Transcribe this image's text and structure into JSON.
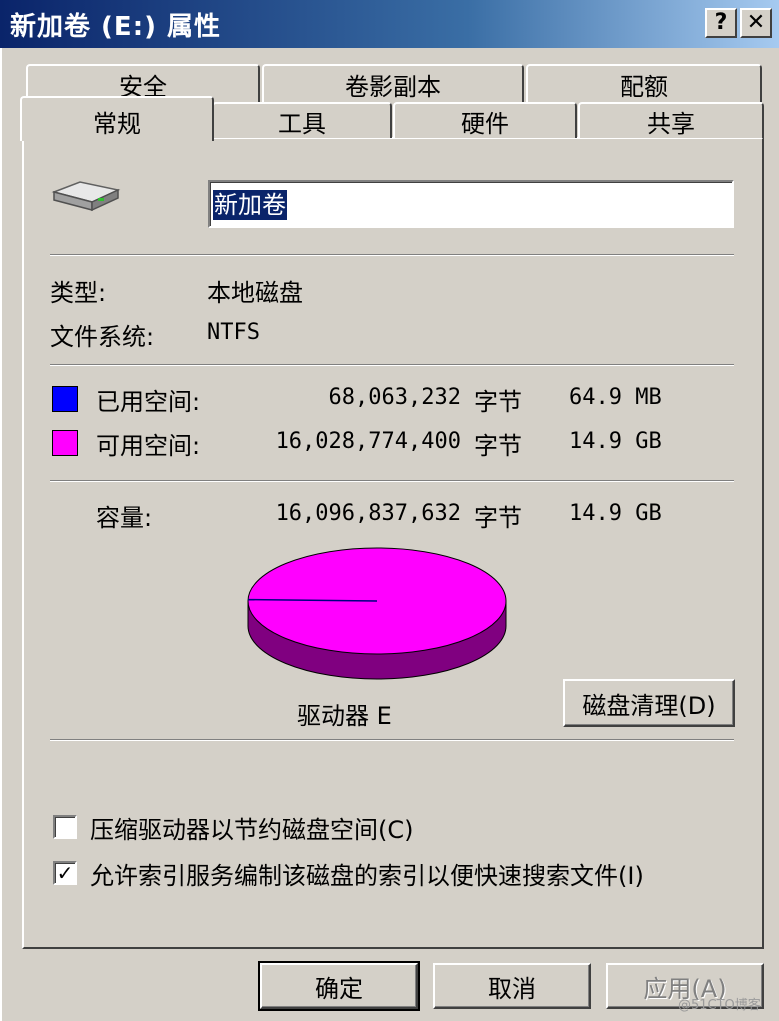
{
  "window": {
    "title": "新加卷 (E:) 属性",
    "help_label": "?",
    "close_label": "✕"
  },
  "tabs": {
    "back": [
      "安全",
      "卷影副本",
      "配额"
    ],
    "front": [
      "常规",
      "工具",
      "硬件",
      "共享"
    ],
    "active": "常规"
  },
  "general": {
    "drive_icon": "hard-drive-icon",
    "volume_name": "新加卷",
    "type_label": "类型:",
    "type_value": "本地磁盘",
    "fs_label": "文件系统:",
    "fs_value": "NTFS",
    "used": {
      "label": "已用空间:",
      "bytes": "68,063,232",
      "unit": "字节",
      "size": "64.9 MB",
      "color": "#0000ff"
    },
    "free": {
      "label": "可用空间:",
      "bytes": "16,028,774,400",
      "unit": "字节",
      "size": "14.9 GB",
      "color": "#ff00ff"
    },
    "capacity": {
      "label": "容量:",
      "bytes": "16,096,837,632",
      "unit": "字节",
      "size": "14.9 GB"
    },
    "drive_label": "驱动器 E",
    "cleanup_button": "磁盘清理(D)",
    "used_fraction": 0.0042,
    "compress_label": "压缩驱动器以节约磁盘空间(C)",
    "compress_checked": false,
    "index_label": "允许索引服务编制该磁盘的索引以便快速搜索文件(I)",
    "index_checked": true,
    "check_glyph": "✓"
  },
  "buttons": {
    "ok": "确定",
    "cancel": "取消",
    "apply": "应用(A)"
  },
  "watermark": "@51CTO博客"
}
